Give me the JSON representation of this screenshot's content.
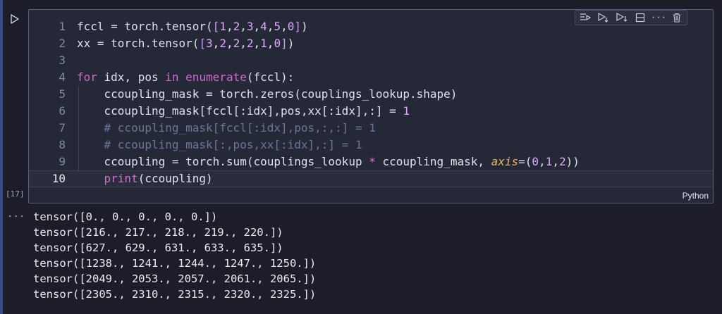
{
  "cell": {
    "execution_count": "[17]",
    "language": "Python",
    "lines": [
      {
        "num": "1",
        "tokens": [
          {
            "t": "fccl = torch.tensor(",
            "c": "fn"
          },
          {
            "t": "[",
            "c": "br"
          },
          {
            "t": "1",
            "c": "num"
          },
          {
            "t": ",",
            "c": "fn"
          },
          {
            "t": "2",
            "c": "num"
          },
          {
            "t": ",",
            "c": "fn"
          },
          {
            "t": "3",
            "c": "num"
          },
          {
            "t": ",",
            "c": "fn"
          },
          {
            "t": "4",
            "c": "num"
          },
          {
            "t": ",",
            "c": "fn"
          },
          {
            "t": "5",
            "c": "num"
          },
          {
            "t": ",",
            "c": "fn"
          },
          {
            "t": "0",
            "c": "num"
          },
          {
            "t": "]",
            "c": "br"
          },
          {
            "t": ")",
            "c": "fn"
          }
        ]
      },
      {
        "num": "2",
        "tokens": [
          {
            "t": "xx = torch.tensor(",
            "c": "fn"
          },
          {
            "t": "[",
            "c": "br"
          },
          {
            "t": "3",
            "c": "num"
          },
          {
            "t": ",",
            "c": "fn"
          },
          {
            "t": "2",
            "c": "num"
          },
          {
            "t": ",",
            "c": "fn"
          },
          {
            "t": "2",
            "c": "num"
          },
          {
            "t": ",",
            "c": "fn"
          },
          {
            "t": "2",
            "c": "num"
          },
          {
            "t": ",",
            "c": "fn"
          },
          {
            "t": "1",
            "c": "num"
          },
          {
            "t": ",",
            "c": "fn"
          },
          {
            "t": "0",
            "c": "num"
          },
          {
            "t": "]",
            "c": "br"
          },
          {
            "t": ")",
            "c": "fn"
          }
        ]
      },
      {
        "num": "3",
        "tokens": []
      },
      {
        "num": "4",
        "tokens": [
          {
            "t": "for",
            "c": "kw"
          },
          {
            "t": " idx, pos ",
            "c": "fn"
          },
          {
            "t": "in",
            "c": "kw"
          },
          {
            "t": " ",
            "c": "fn"
          },
          {
            "t": "enumerate",
            "c": "kw"
          },
          {
            "t": "(fccl):",
            "c": "fn"
          }
        ]
      },
      {
        "num": "5",
        "tokens": [
          {
            "t": "    ccoupling_mask = torch.zeros(couplings_lookup.shape)",
            "c": "fn"
          }
        ]
      },
      {
        "num": "6",
        "tokens": [
          {
            "t": "    ccoupling_mask[fccl[:idx],pos,xx[:idx],:] = ",
            "c": "fn"
          },
          {
            "t": "1",
            "c": "num"
          }
        ]
      },
      {
        "num": "7",
        "tokens": [
          {
            "t": "    # ccoupling_mask[fccl[:idx],pos,:,:] = 1",
            "c": "com"
          }
        ]
      },
      {
        "num": "8",
        "tokens": [
          {
            "t": "    # ccoupling_mask[:,pos,xx[:idx],:] = 1",
            "c": "com"
          }
        ]
      },
      {
        "num": "9",
        "tokens": [
          {
            "t": "    ccoupling = torch.sum(couplings_lookup ",
            "c": "fn"
          },
          {
            "t": "*",
            "c": "op"
          },
          {
            "t": " ccoupling_mask, ",
            "c": "fn"
          },
          {
            "t": "axis",
            "c": "param"
          },
          {
            "t": "=(",
            "c": "fn"
          },
          {
            "t": "0",
            "c": "num"
          },
          {
            "t": ",",
            "c": "fn"
          },
          {
            "t": "1",
            "c": "num"
          },
          {
            "t": ",",
            "c": "fn"
          },
          {
            "t": "2",
            "c": "num"
          },
          {
            "t": "))",
            "c": "fn"
          }
        ]
      },
      {
        "num": "10",
        "current": true,
        "tokens": [
          {
            "t": "    ",
            "c": "fn"
          },
          {
            "t": "print",
            "c": "kw"
          },
          {
            "t": "(ccoupling)",
            "c": "fn"
          }
        ]
      }
    ]
  },
  "output": {
    "menu_label": "...",
    "lines": [
      "tensor([0., 0., 0., 0., 0.])",
      "tensor([216., 217., 218., 219., 220.])",
      "tensor([627., 629., 631., 633., 635.])",
      "tensor([1238., 1241., 1244., 1247., 1250.])",
      "tensor([2049., 2053., 2057., 2061., 2065.])",
      "tensor([2305., 2310., 2315., 2320., 2325.])"
    ]
  },
  "toolbar": {
    "icons": [
      "execute-above-icon",
      "execute-cell-below-icon",
      "execute-below-icon",
      "split-cell-icon",
      "more-actions-icon",
      "delete-cell-icon"
    ],
    "more_label": "···"
  },
  "colors": {
    "background": "#1c1d28",
    "cell_background": "#252836",
    "keyword": "#d06bd0",
    "number": "#e0a8ff",
    "comment": "#6c7499",
    "parameter": "#e5b95c"
  }
}
